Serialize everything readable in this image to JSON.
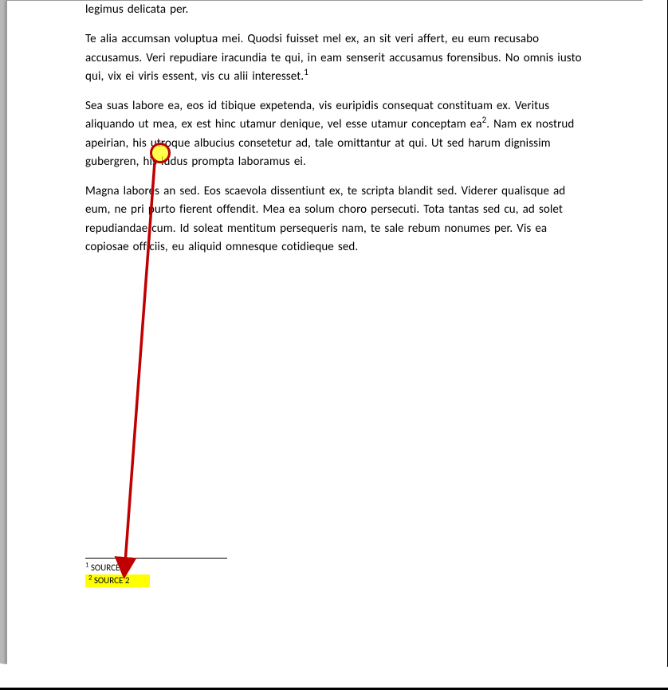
{
  "paragraphs": {
    "p1": "legimus delicata per.",
    "p2_before": "Te alia accumsan voluptua mei. Quodsi fuisset mel ex, an sit veri affert, eu eum recusabo accusamus. Veri repudiare iracundia te qui, in eam senserit accusamus forensibus. No omnis iusto qui, vix ei viris essent, vis cu alii interesset.",
    "p2_ref": "1",
    "p3_before": "Sea suas labore ea, eos id tibique expetenda, vis euripidis consequat constituam ex. Veritus aliquando ut mea, ex est hinc utamur denique, vel esse utamur conceptam ea",
    "p3_ref": "2",
    "p3_after": ". Nam ex nostrud apeirian, his utroque albucius consetetur ad, tale omittantur at qui. Ut sed harum dignissim gubergren, his ludus prompta laboramus ei.",
    "p4": "Magna labores an sed. Eos scaevola dissentiunt ex, te scripta blandit sed. Viderer qualisque ad eum, ne pri purto fierent offendit. Mea ea solum choro persecuti. Tota tantas sed cu, ad solet repudiandae cum. Id soleat mentitum persequeris nam, te sale rebum nonumes per. Vis ea copiosae officiis, eu aliquid omnesque cotidieque sed."
  },
  "footnotes": {
    "f1_num": "1",
    "f1_text": " SOURCE 1",
    "f2_num": "2",
    "f2_text": " SOURCE 2"
  }
}
